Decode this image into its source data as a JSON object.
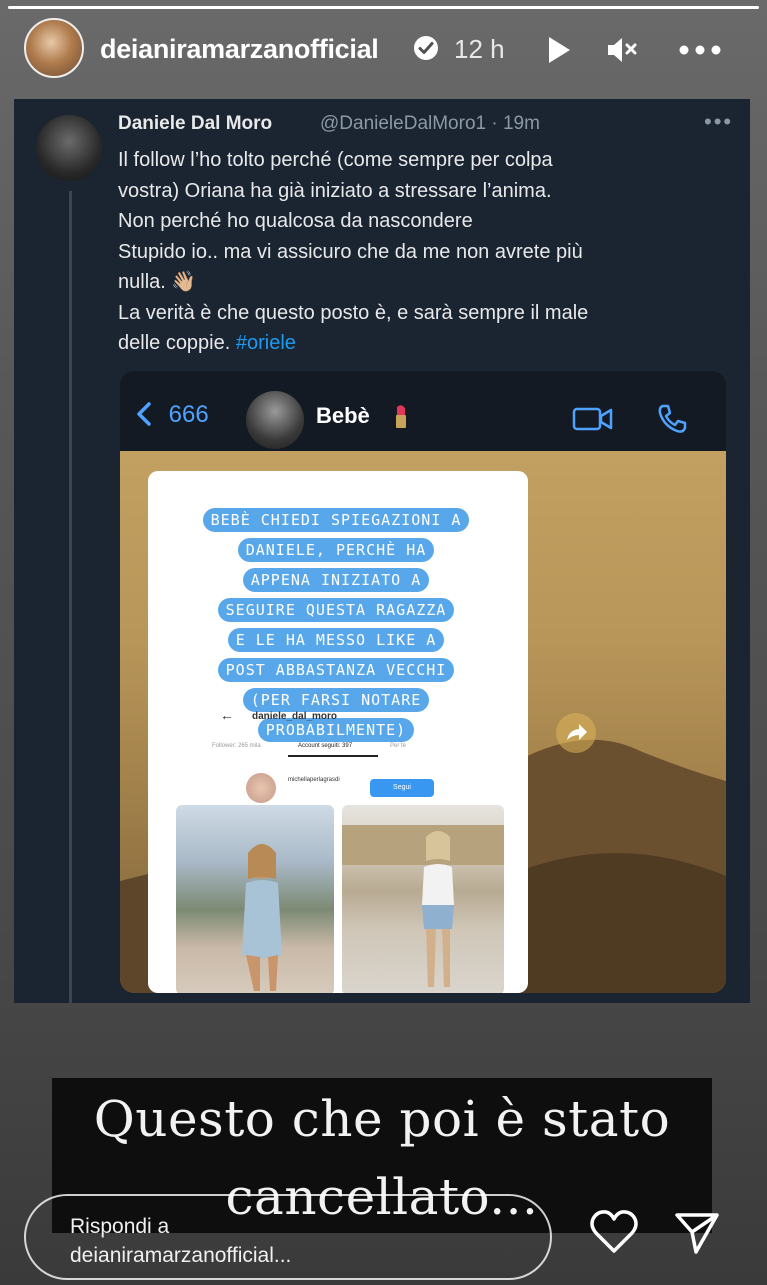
{
  "header": {
    "username": "deianiramarzanofficial",
    "time": "12 h",
    "progress": 1.0
  },
  "tweet": {
    "author_name": "Daniele Dal Moro",
    "handle_time": "@DanieleDalMoro1 · 19m",
    "lines": [
      "Il follow l’ho tolto perché (come sempre per colpa",
      "vostra) Oriana ha già iniziato a stressare l’anima.",
      "Non perché ho qualcosa da nascondere",
      "Stupido io.. ma vi assicuro che da me non avrete più",
      "nulla. 👋🏼",
      "La verità è che questo posto è, e sarà sempre il male"
    ],
    "last_line_text": "delle coppie. ",
    "hashtag": "#oriele"
  },
  "chat": {
    "back_count": "666",
    "contact_name": "Bebè",
    "message_lines": [
      "BEBÈ CHIEDI SPIEGAZIONI A",
      "DANIELE, PERCHÈ HA",
      "APPENA INIZIATO A",
      "SEGUIRE QUESTA RAGAZZA",
      "E LE HA MESSO LIKE A",
      "POST ABBASTANZA VECCHI",
      "(PER FARSI NOTARE",
      "PROBABILMENTE)"
    ],
    "ig_username": "daniele_dal_moro",
    "ig_tab_followers": "Follower: 265 mila",
    "ig_tab_following": "Account seguiti: 397",
    "ig_tab_other": "Per te",
    "ig_profile_name": "michellaperlagrasdi",
    "ig_follow_button": "Segui"
  },
  "caption": {
    "line1": "Questo che poi è stato",
    "line2": "cancellato..."
  },
  "reply": {
    "line1": "Rispondi a",
    "line2": "deianiramarzanofficial..."
  },
  "icons": [
    "play-icon",
    "mute-icon",
    "more-icon",
    "verified-icon",
    "heart-icon",
    "send-icon",
    "video-call-icon",
    "phone-icon",
    "share-icon"
  ],
  "colors": {
    "tweet_bg": "#1b2431",
    "hashtag": "#1d9bf0",
    "chat_blue": "#58a7ea",
    "caption_bg": "#0e0e0e"
  }
}
